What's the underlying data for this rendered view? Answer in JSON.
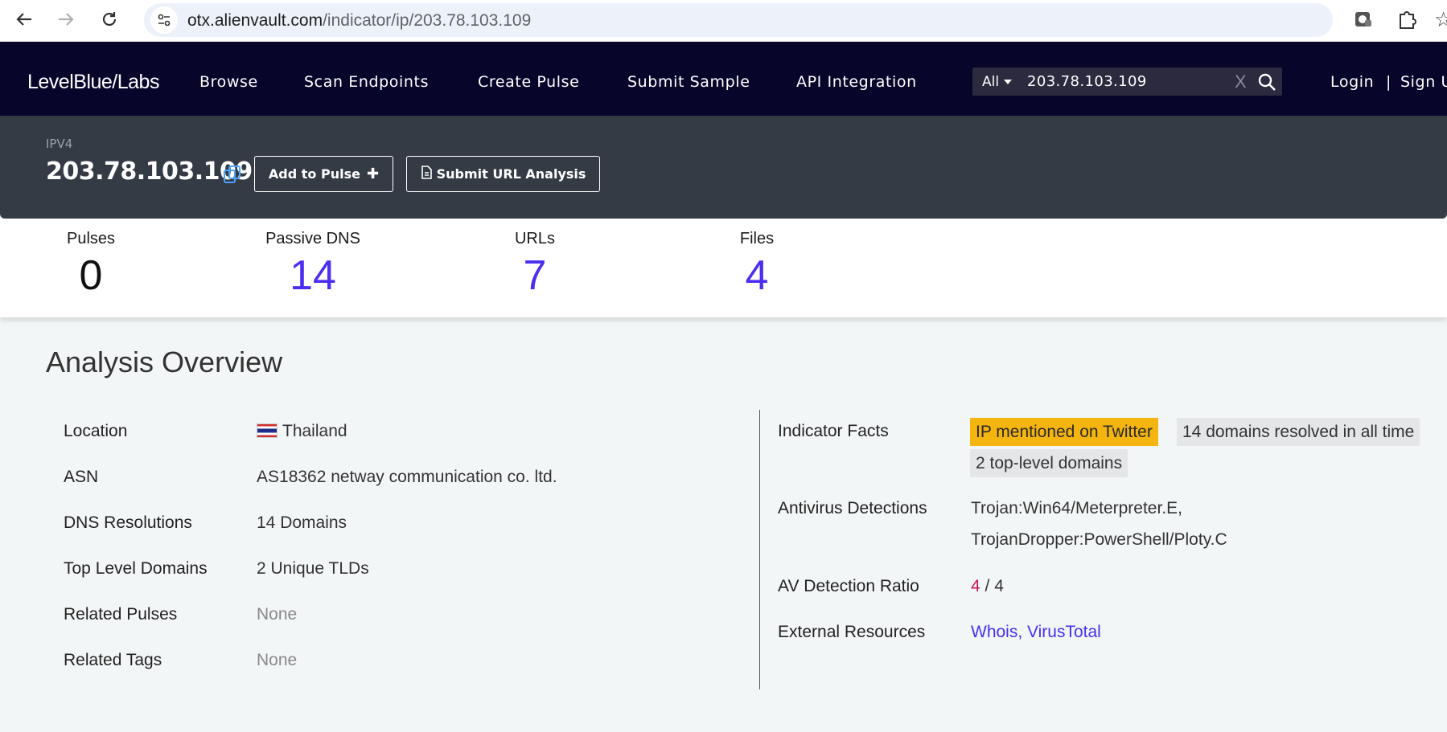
{
  "browser": {
    "url_host": "otx.alienvault.com",
    "url_path": "/indicator/ip/203.78.103.109",
    "icons": [
      "back-arrow-icon",
      "forward-arrow-icon",
      "reload-icon",
      "site-settings-icon",
      "star-icon",
      "extension-icon",
      "puzzle-icon"
    ]
  },
  "navbar": {
    "logo": "LevelBlue/Labs",
    "menu": [
      "Browse",
      "Scan Endpoints",
      "Create Pulse",
      "Submit Sample",
      "API Integration"
    ],
    "search": {
      "scope": "All",
      "value": "203.78.103.109",
      "clear": "X"
    },
    "login": "Login",
    "separator": "|",
    "signup": "Sign U"
  },
  "indicator": {
    "type": "IPV4",
    "value": "203.78.103.109",
    "add_to_pulse": "Add to Pulse",
    "submit_url": "Submit URL Analysis"
  },
  "stats": [
    {
      "label": "Pulses",
      "value": "0"
    },
    {
      "label": "Passive DNS",
      "value": "14"
    },
    {
      "label": "URLs",
      "value": "7"
    },
    {
      "label": "Files",
      "value": "4"
    }
  ],
  "overview": {
    "title": "Analysis Overview",
    "left": [
      {
        "label": "Location",
        "value": "Thailand"
      },
      {
        "label": "ASN",
        "value": "AS18362 netway communication co. ltd."
      },
      {
        "label": "DNS Resolutions",
        "value": "14 Domains"
      },
      {
        "label": "Top Level Domains",
        "value": "2 Unique TLDs"
      },
      {
        "label": "Related Pulses",
        "value": "None"
      },
      {
        "label": "Related Tags",
        "value": "None"
      }
    ],
    "right": {
      "facts_label": "Indicator Facts",
      "facts": [
        "IP mentioned on Twitter",
        "14 domains resolved in all time",
        "2 top-level domains"
      ],
      "av_label": "Antivirus Detections",
      "av_values": [
        "Trojan:Win64/Meterpreter.E,",
        "TrojanDropper:PowerShell/Ploty.C"
      ],
      "ratio_label": "AV Detection Ratio",
      "ratio_detected": "4",
      "ratio_rest": " / 4",
      "ext_label": "External Resources",
      "ext_links": "Whois, VirusTotal"
    }
  },
  "colors": {
    "accent": "#4b2ff0",
    "navbar": "#07052a",
    "header": "#353b45",
    "highlight": "#f5b50f"
  }
}
